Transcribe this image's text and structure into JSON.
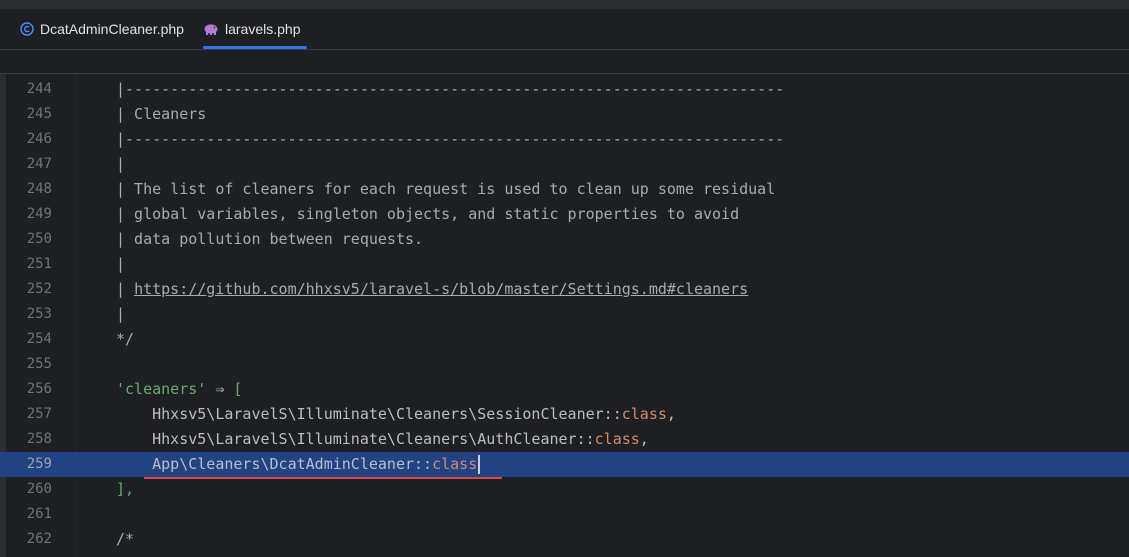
{
  "tabs": [
    {
      "label": "DcatAdminCleaner.php",
      "icon": "php-class-icon",
      "active": false
    },
    {
      "label": "laravels.php",
      "icon": "php-elephant-icon",
      "active": true
    }
  ],
  "colors": {
    "accent": "#3574f0",
    "current_line": "#214283",
    "error": "#e0443a"
  },
  "lines": [
    {
      "num": "244",
      "comment": "|-------------------------------------------------------------------------"
    },
    {
      "num": "245",
      "comment": "| Cleaners"
    },
    {
      "num": "246",
      "comment": "|-------------------------------------------------------------------------"
    },
    {
      "num": "247",
      "comment": "|"
    },
    {
      "num": "248",
      "comment": "| The list of cleaners for each request is used to clean up some residual"
    },
    {
      "num": "249",
      "comment": "| global variables, singleton objects, and static properties to avoid"
    },
    {
      "num": "250",
      "comment": "| data pollution between requests."
    },
    {
      "num": "251",
      "comment": "|"
    },
    {
      "num": "252",
      "prefix": "| ",
      "link": "https://github.com/hhxsv5/laravel-s/blob/master/Settings.md#cleaners"
    },
    {
      "num": "253",
      "comment": "|"
    },
    {
      "num": "254",
      "comment": "*/"
    },
    {
      "num": "255"
    },
    {
      "num": "256",
      "string": "'cleaners'",
      "op": " ⇒ ",
      "bracket": "["
    },
    {
      "num": "257",
      "ns": "    Hhxsv5\\LaravelS\\Illuminate\\Cleaners\\SessionCleaner",
      "sep": "::",
      "kw": "class",
      "tail": ","
    },
    {
      "num": "258",
      "ns": "    Hhxsv5\\LaravelS\\Illuminate\\Cleaners\\AuthCleaner",
      "sep": "::",
      "kw": "class",
      "tail": ","
    },
    {
      "num": "259",
      "ns": "    App\\Cleaners\\DcatAdminCleaner",
      "sep": "::",
      "kw": "class"
    },
    {
      "num": "260",
      "close": "],"
    },
    {
      "num": "261"
    },
    {
      "num": "262",
      "comment": "/*"
    }
  ]
}
